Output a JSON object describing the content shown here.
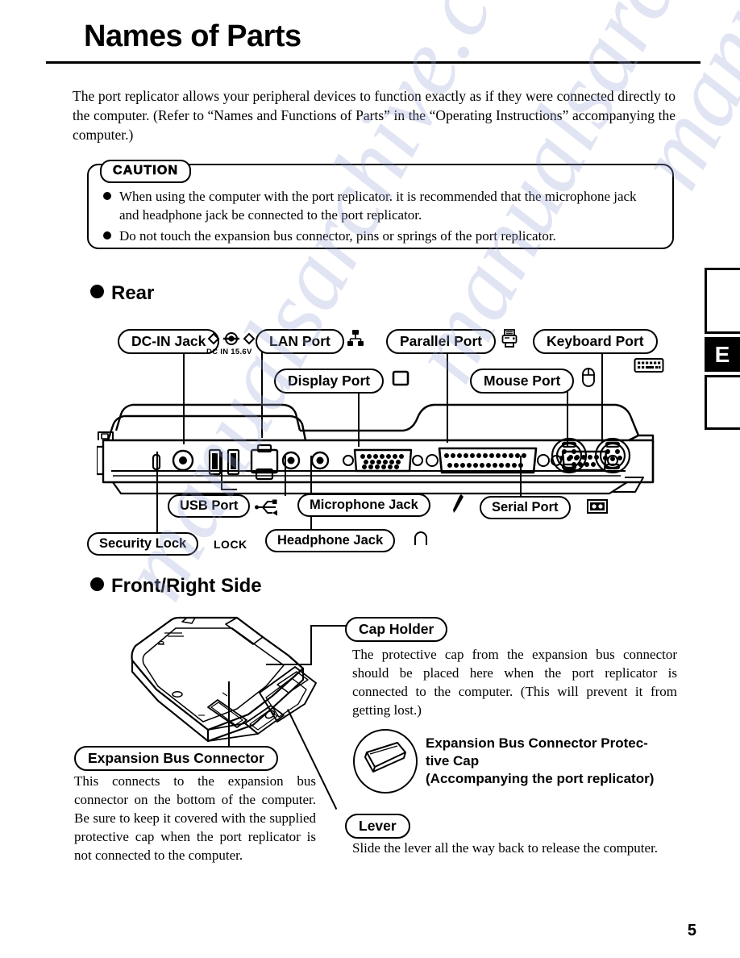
{
  "page": {
    "title": "Names of Parts",
    "number": "5",
    "edge_tab_letter": "E",
    "watermark": "manualsarchive.com"
  },
  "intro": "The port replicator allows your peripheral devices to function exactly as if they were connected directly to the computer. (Refer to “Names and Functions of Parts” in the “Operating Instructions” accompanying the computer.)",
  "caution": {
    "badge": "CAUTION",
    "items": [
      "When using the computer with the port replicator. it is recommended that the microphone jack and headphone jack be connected to the port replicator.",
      "Do not touch the expansion bus connector, pins or springs of the port replicator."
    ]
  },
  "sections": {
    "rear": {
      "heading": "Rear",
      "labels": {
        "dc_in_jack": "DC-IN Jack",
        "dc_in_rating": "DC IN 15.6V",
        "lan_port": "LAN Port",
        "display_port": "Display Port",
        "parallel_port": "Parallel Port",
        "mouse_port": "Mouse Port",
        "keyboard_port": "Keyboard Port",
        "usb_port": "USB Port",
        "security_lock": "Security Lock",
        "security_lock_mark": "LOCK",
        "microphone_jack": "Microphone Jack",
        "headphone_jack": "Headphone Jack",
        "serial_port": "Serial Port"
      }
    },
    "front_right": {
      "heading": "Front/Right Side",
      "cap_holder": {
        "label": "Cap Holder",
        "text": "The protective cap from the expansion bus connector should be placed here when the port replicator is connected to the computer. (This will prevent it from getting lost.)"
      },
      "protective_cap": {
        "line1": "Expansion Bus Connector Protec-",
        "line2": "tive Cap",
        "line3": "(Accompanying the port replicator)"
      },
      "expansion_bus_connector": {
        "label": "Expansion Bus Connector",
        "text": "This connects to the expansion bus connector on the bottom of the computer. Be sure to keep it covered with the supplied protective cap when the port replicator is not connected to the computer."
      },
      "lever": {
        "label": "Lever",
        "text": "Slide the lever all the way back to release the computer."
      }
    }
  },
  "colors": {
    "ink": "#000000",
    "paper": "#ffffff",
    "watermark": "#9aa4d8"
  }
}
